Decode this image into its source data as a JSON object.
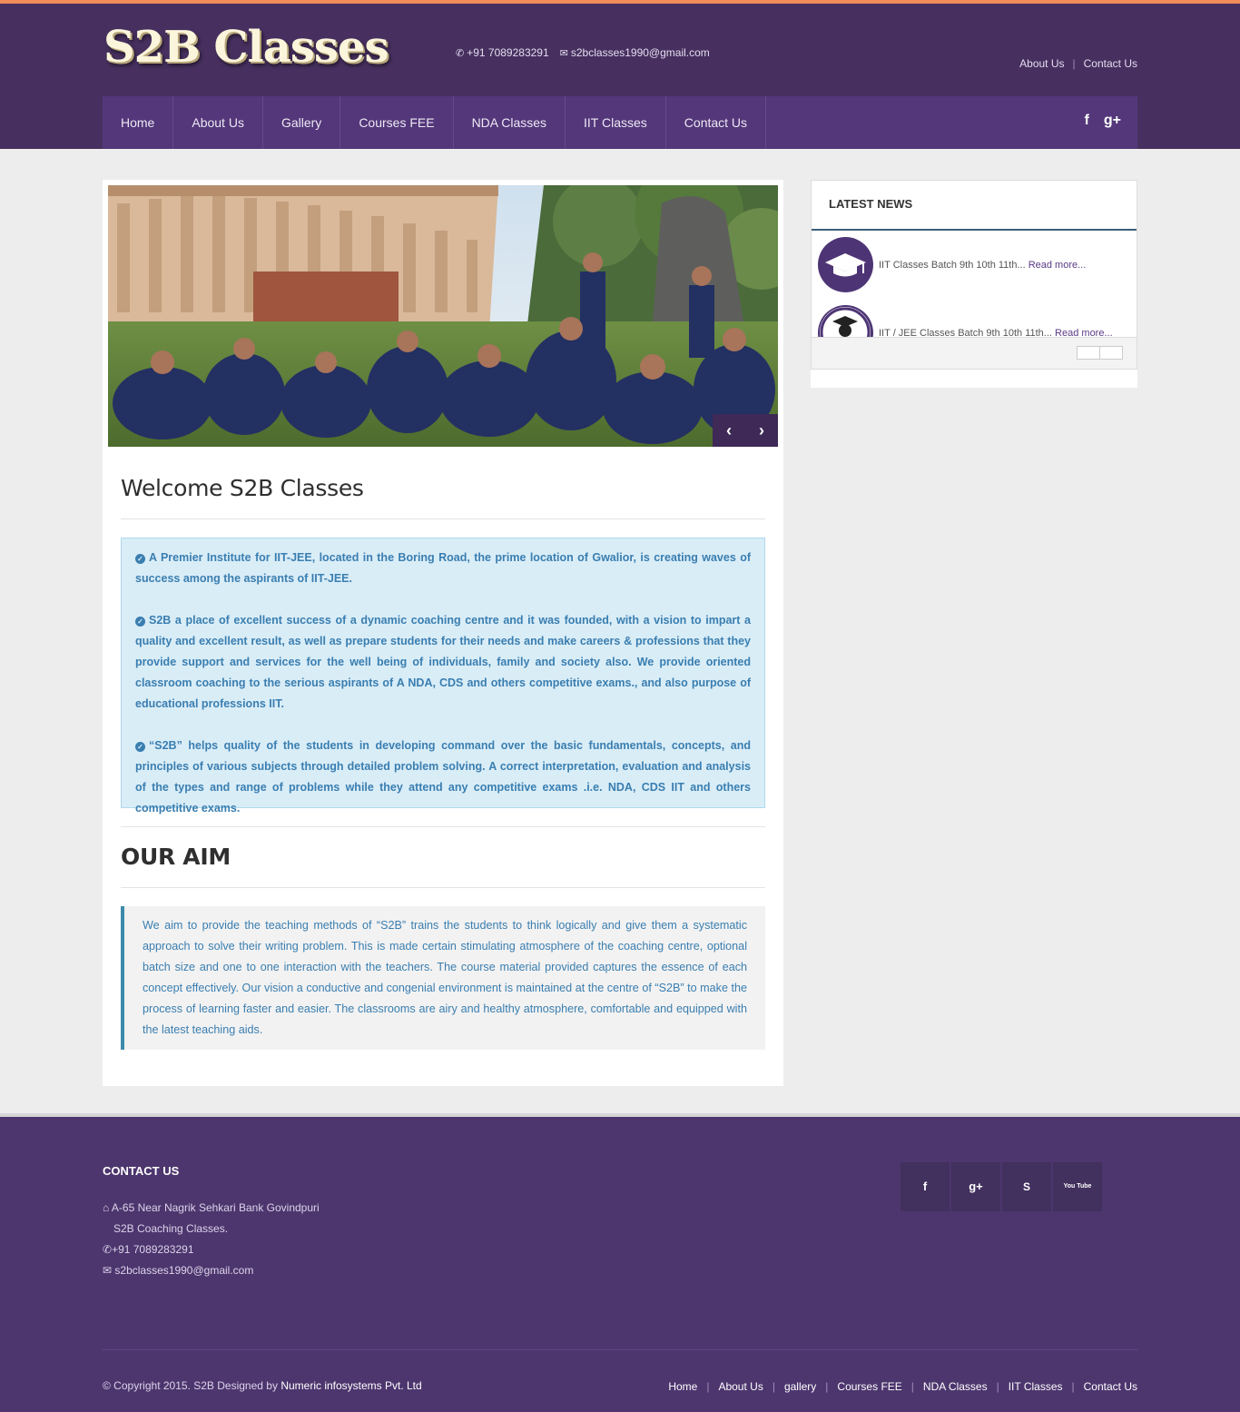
{
  "site": {
    "logo_text": "S2B Classes"
  },
  "header": {
    "phone": "+91 7089283291",
    "email": "s2bclasses1990@gmail.com",
    "top_links": [
      "About Us",
      "Contact Us"
    ]
  },
  "nav": {
    "items": [
      "Home",
      "About Us",
      "Gallery",
      "Courses FEE",
      "NDA Classes",
      "IIT Classes",
      "Contact Us"
    ],
    "social": [
      "f",
      "g+"
    ]
  },
  "slider": {
    "prev_label": "‹",
    "next_label": "›"
  },
  "welcome": {
    "title": "Welcome S2B Classes",
    "paragraphs": [
      "A Premier Institute for IIT-JEE, located in the Boring Road, the prime location of Gwalior, is creating waves of success among the aspirants of IIT-JEE.",
      "S2B a place of excellent success of a dynamic coaching centre and it was founded, with a vision to impart a quality and excellent result, as well as prepare students for their needs and make careers & professions that they provide support and services for the well being of individuals, family and society also. We provide oriented classroom coaching to the serious aspirants of A NDA, CDS and others competitive exams., and also purpose of educational professions IIT.",
      "“S2B” helps quality of the students in developing command over the basic fundamentals, concepts, and principles of various subjects through detailed problem solving. A correct interpretation, evaluation and analysis of the types and range of problems while they attend any competitive exams .i.e. NDA, CDS IIT and others competitive exams."
    ]
  },
  "aim": {
    "title": "OUR AIM",
    "text": "We aim to provide the teaching methods of “S2B” trains the students to think logically and give them a systematic approach to solve their writing problem. This is made certain stimulating atmosphere of the coaching centre, optional batch size and one to one interaction with the teachers. The course material provided captures the essence of each concept effectively. Our vision a conductive and congenial environment is maintained at the centre of “S2B” to make the process of learning faster and easier. The classrooms are airy and healthy atmosphere, comfortable and equipped with the latest teaching aids."
  },
  "news": {
    "title": "LATEST NEWS",
    "items": [
      {
        "text": "IIT Classes Batch 9th 10th 11th...",
        "more": "Read more...",
        "icon": "graduation-cap-icon"
      },
      {
        "text": "IIT / JEE Classes Batch 9th 10th 11th...",
        "more": "Read more...",
        "icon": "graduate-student-icon"
      }
    ]
  },
  "footer": {
    "contact_title": "CONTACT US",
    "address_line1": "A-65  Near  Nagrik  Sehkari  Bank  Govindpuri",
    "address_line2": "S2B Coaching Classes.",
    "phone": "+91 7089283291",
    "email": "s2bclasses1990@gmail.com",
    "social": [
      "f",
      "g+",
      "S",
      "You Tube"
    ],
    "copyright": "© Copyright 2015. S2B Designed by",
    "designer": "Numeric infosystems Pvt. Ltd",
    "links": [
      "Home",
      "About Us",
      "gallery",
      "Courses FEE",
      "NDA Classes",
      "IIT Classes",
      "Contact Us"
    ]
  },
  "colors": {
    "header_bg": "#47305f",
    "nav_bg": "#53377a",
    "accent_top": "#f08c5a",
    "footer_bg": "#4d366e",
    "info_text": "#3a7eb0"
  }
}
